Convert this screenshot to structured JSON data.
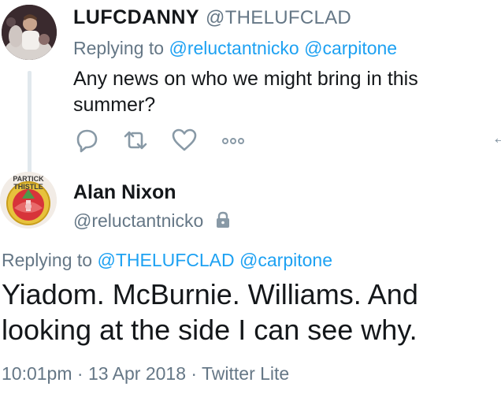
{
  "reply_tweet": {
    "author_name": "LUFCDANNY",
    "author_handle": "@THELUFCLAD",
    "replying_prefix": "Replying to",
    "replying_handles": [
      "@reluctantnicko",
      "@carpitone"
    ],
    "text": "Any news on who we might bring in this summer?",
    "actions": [
      {
        "name": "reply-icon"
      },
      {
        "name": "retweet-icon"
      },
      {
        "name": "like-icon"
      },
      {
        "name": "more-icon"
      }
    ]
  },
  "main_tweet": {
    "author_name": "Alan Nixon",
    "author_handle": "@reluctantnicko",
    "protected_icon": "lock-icon",
    "avatar_badge_text": [
      "PARTICK",
      "THISTLE"
    ],
    "replying_prefix": "Replying to",
    "replying_handles": [
      "@THELUFCLAD",
      "@carpitone"
    ],
    "text": "Yiadom. McBurnie. Williams. And looking at the side I can see why.",
    "timestamp": "10:01pm · 13 Apr 2018 · Twitter Lite"
  },
  "colors": {
    "text": "#14171a",
    "secondary": "#657786",
    "link": "#1da1f2",
    "thread_line": "#e1e8ed"
  }
}
